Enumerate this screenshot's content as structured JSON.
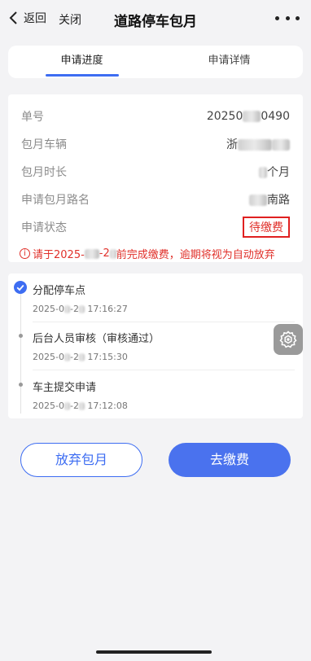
{
  "nav": {
    "back_label": "返回",
    "close_label": "关闭",
    "title": "道路停车包月"
  },
  "tabs": [
    {
      "label": "申请进度",
      "active": true
    },
    {
      "label": "申请详情",
      "active": false
    }
  ],
  "info": {
    "order_no": {
      "label": "单号",
      "value_prefix": "20250",
      "value_suffix": "0490"
    },
    "vehicle": {
      "label": "包月车辆",
      "value_prefix": "浙"
    },
    "duration": {
      "label": "包月时长",
      "value_suffix": "个月"
    },
    "road": {
      "label": "申请包月路名",
      "value_suffix": "南路"
    },
    "status": {
      "label": "申请状态",
      "value": "待缴费"
    },
    "warning": {
      "icon": "info-icon",
      "prefix": "请于2025-",
      "middle": "-2",
      "suffix": "前完成缴费，逾期将视为自动放弃"
    }
  },
  "timeline": [
    {
      "title": "分配停车点",
      "time_prefix": "2025-0",
      "time_mid": "-2",
      "time_suffix": " 17:16:27",
      "done": true
    },
    {
      "title": "后台人员审核（审核通过）",
      "time_prefix": "2025-0",
      "time_mid": "-2",
      "time_suffix": " 17:15:30",
      "done": false
    },
    {
      "title": "车主提交申请",
      "time_prefix": "2025-0",
      "time_mid": "-2",
      "time_suffix": " 17:12:08",
      "done": false
    }
  ],
  "actions": {
    "abandon_label": "放弃包月",
    "pay_label": "去缴费"
  },
  "colors": {
    "accent": "#3d6df2",
    "warning": "#e0302a",
    "status_border": "#e02020"
  }
}
